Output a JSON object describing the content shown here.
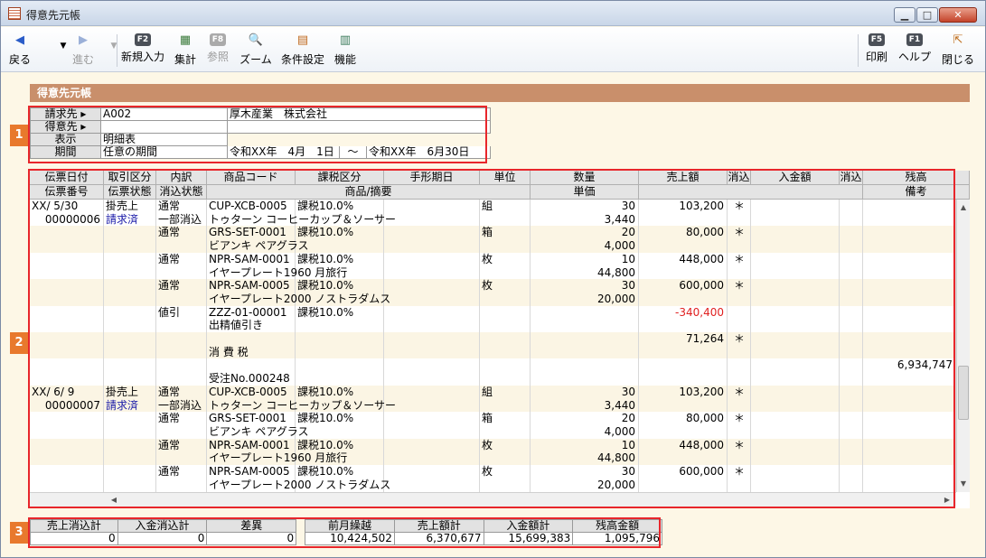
{
  "window": {
    "title": "得意先元帳"
  },
  "toolbar": {
    "back": "戻る",
    "forward": "進む",
    "new_entry": {
      "key": "F2",
      "label": "新規入力"
    },
    "total": "集計",
    "reference": {
      "key": "F8",
      "label": "参照"
    },
    "zoom": "ズーム",
    "condition": "条件設定",
    "function": "機能",
    "print": {
      "key": "F5",
      "label": "印刷"
    },
    "help": {
      "key": "F1",
      "label": "ヘルプ"
    },
    "close": "閉じる"
  },
  "section_title": "得意先元帳",
  "info": {
    "billing_label": "請求先",
    "billing_code": "A002",
    "billing_name": "厚木産業　株式会社",
    "customer_label": "得意先",
    "display_label": "表示",
    "display_value": "明細表",
    "period_label": "期間",
    "period_value": "任意の期間",
    "period_from": "令和XX年　4月　1日",
    "period_sep": "～",
    "period_to": "令和XX年　6月30日"
  },
  "badges": [
    "1",
    "2",
    "3"
  ],
  "grid": {
    "headers1": [
      "伝票日付",
      "取引区分",
      "内訳",
      "商品コード",
      "課税区分",
      "手形期日",
      "単位",
      "数量",
      "売上額",
      "消込",
      "入金額",
      "消込",
      "残高"
    ],
    "headers2": [
      "伝票番号",
      "伝票状態",
      "消込状態",
      "商品/摘要",
      "単価",
      "備考"
    ],
    "rows": [
      {
        "date": "XX/ 5/30",
        "type": "掛売上",
        "sub": "通常",
        "code": "CUP-XCB-0005",
        "tax": "課税10.0%",
        "unit": "組",
        "qty": "30",
        "amount": "103,200",
        "mark": "＊"
      },
      {
        "no": "00000006",
        "status": "請求済",
        "sub": "一部消込",
        "name": "トゥターン コーヒーカップ＆ソーサー",
        "price": "3,440"
      },
      {
        "sub": "通常",
        "code": "GRS-SET-0001",
        "tax": "課税10.0%",
        "unit": "箱",
        "qty": "20",
        "amount": "80,000",
        "mark": "＊"
      },
      {
        "name": "ビアンキ ペアグラス",
        "price": "4,000"
      },
      {
        "sub": "通常",
        "code": "NPR-SAM-0001",
        "tax": "課税10.0%",
        "unit": "枚",
        "qty": "10",
        "amount": "448,000",
        "mark": "＊"
      },
      {
        "name": "イヤープレート1960 月旅行",
        "price": "44,800"
      },
      {
        "sub": "通常",
        "code": "NPR-SAM-0005",
        "tax": "課税10.0%",
        "unit": "枚",
        "qty": "30",
        "amount": "600,000",
        "mark": "＊"
      },
      {
        "name": "イヤープレート2000 ノストラダムス",
        "price": "20,000"
      },
      {
        "sub": "値引",
        "code": "ZZZ-01-00001",
        "tax": "課税10.0%",
        "amount": "-340,400"
      },
      {
        "name": "出精値引き"
      },
      {
        "amount": "71,264",
        "mark": "＊"
      },
      {
        "name": "消 費 税"
      },
      {
        "balance": "6,934,747"
      },
      {
        "name": "受注No.000248"
      },
      {
        "date": "XX/ 6/ 9",
        "type": "掛売上",
        "sub": "通常",
        "code": "CUP-XCB-0005",
        "tax": "課税10.0%",
        "unit": "組",
        "qty": "30",
        "amount": "103,200",
        "mark": "＊"
      },
      {
        "no": "00000007",
        "status": "請求済",
        "sub": "一部消込",
        "name": "トゥターン コーヒーカップ＆ソーサー",
        "price": "3,440"
      },
      {
        "sub": "通常",
        "code": "GRS-SET-0001",
        "tax": "課税10.0%",
        "unit": "箱",
        "qty": "20",
        "amount": "80,000",
        "mark": "＊"
      },
      {
        "name": "ビアンキ ペアグラス",
        "price": "4,000"
      },
      {
        "sub": "通常",
        "code": "NPR-SAM-0001",
        "tax": "課税10.0%",
        "unit": "枚",
        "qty": "10",
        "amount": "448,000",
        "mark": "＊"
      },
      {
        "name": "イヤープレート1960 月旅行",
        "price": "44,800"
      },
      {
        "sub": "通常",
        "code": "NPR-SAM-0005",
        "tax": "課税10.0%",
        "unit": "枚",
        "qty": "30",
        "amount": "600,000",
        "mark": "＊"
      },
      {
        "name": "イヤープレート2000 ノストラダムス",
        "price": "20,000"
      }
    ]
  },
  "totals": {
    "labels": [
      "売上消込計",
      "入金消込計",
      "差異",
      "前月繰越",
      "売上額計",
      "入金額計",
      "残高金額"
    ],
    "values": [
      "0",
      "0",
      "0",
      "10,424,502",
      "6,370,677",
      "15,699,383",
      "1,095,796"
    ]
  },
  "colors": {
    "accent_bar": "#c98f6b",
    "highlight": "#e8262b",
    "badge": "#e8792d",
    "negative": "#e02020",
    "status_link": "#1a1aa8"
  }
}
